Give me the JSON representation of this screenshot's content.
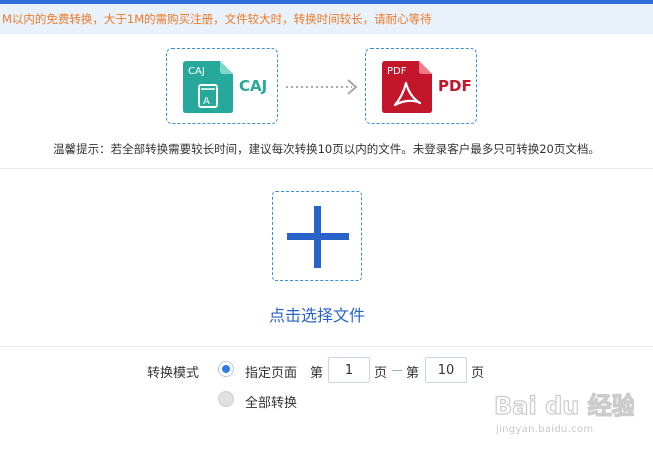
{
  "notice": {
    "text": "M以内的免费转换，大于1M的需购买注册，文件较大时，转换时间较长，请耐心等待"
  },
  "conversion": {
    "source": {
      "icon_text": "CAJ",
      "label": "CAJ",
      "color": "#26a99a"
    },
    "target": {
      "icon_text": "PDF",
      "label": "PDF",
      "color": "#c4162a"
    }
  },
  "tip": {
    "text": "温馨提示：若全部转换需要较长时间，建议每次转换10页以内的文件。未登录客户最多只可转换20页文档。"
  },
  "upload": {
    "link_text": "点击选择文件",
    "accent": "#2a63c8"
  },
  "mode": {
    "label": "转换模式",
    "option_range": {
      "label": "指定页面",
      "selected": true,
      "prefix_from": "第",
      "from_value": "1",
      "suffix_from": "页",
      "prefix_to": "第",
      "to_value": "10",
      "suffix_to": "页"
    },
    "option_all": {
      "label": "全部转换",
      "selected": false
    }
  },
  "watermark": {
    "main": "Bai du 经验",
    "sub": "jingyan.baidu.com"
  },
  "icons": {
    "source_file": "caj-file-icon",
    "target_file": "pdf-file-icon",
    "arrow": "arrow-right-icon",
    "add": "plus-icon"
  }
}
